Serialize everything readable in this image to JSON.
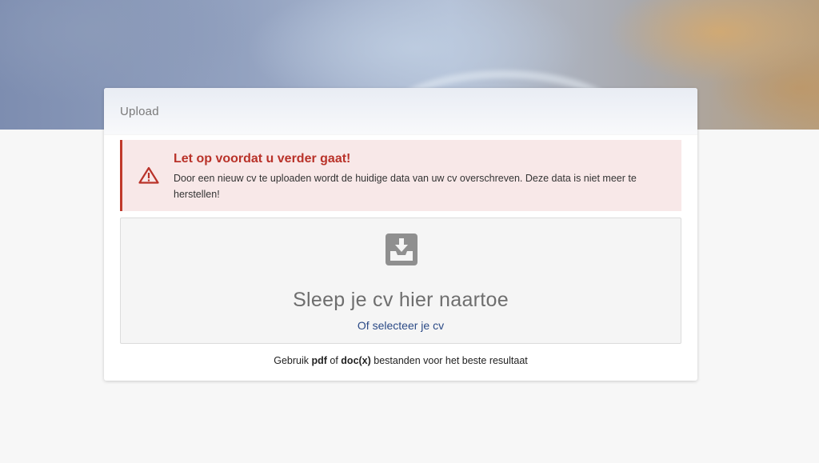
{
  "card": {
    "title": "Upload"
  },
  "alert": {
    "icon": "warning-triangle-icon",
    "title": "Let op voordat u verder gaat!",
    "message": "Door een nieuw cv te uploaden wordt de huidige data van uw cv overschreven. Deze data is niet meer te herstellen!",
    "color": "#b93229",
    "background": "#f8e8e8"
  },
  "dropzone": {
    "icon": "inbox-download-icon",
    "title": "Sleep je cv hier naartoe",
    "select_link": "Of selecteer je cv",
    "link_color": "#2b4a86"
  },
  "hint": {
    "prefix": "Gebruik ",
    "format1": "pdf",
    "middle": " of ",
    "format2": "doc(x)",
    "suffix": " bestanden voor het beste resultaat"
  }
}
